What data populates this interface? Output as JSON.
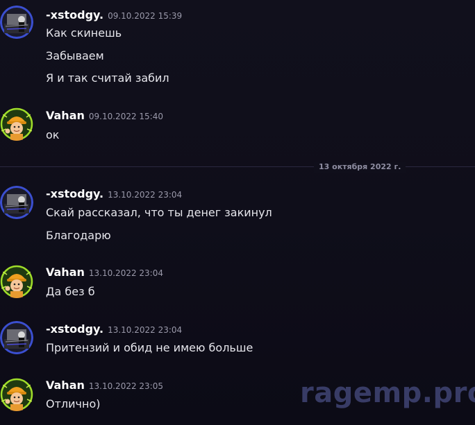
{
  "date_divider": "13 октября 2022 г.",
  "watermark": "ragemp.pro",
  "messages": [
    {
      "username": "-xstodgy.",
      "timestamp": "09.10.2022 15:39",
      "lines": [
        "Как скинешь",
        "Забываем",
        "Я и так считай забил"
      ]
    },
    {
      "username": "Vahan",
      "timestamp": "09.10.2022 15:40",
      "lines": [
        "ок"
      ]
    },
    {
      "username": "-xstodgy.",
      "timestamp": "13.10.2022 23:04",
      "lines": [
        "Скай рассказал, что ты денег закинул",
        "Благодарю"
      ]
    },
    {
      "username": "Vahan",
      "timestamp": "13.10.2022 23:04",
      "lines": [
        "Да без б"
      ]
    },
    {
      "username": "-xstodgy.",
      "timestamp": "13.10.2022 23:04",
      "lines": [
        "Притензий и обид не имею больше"
      ]
    },
    {
      "username": "Vahan",
      "timestamp": "13.10.2022 23:05",
      "lines": [
        "Отлично)"
      ]
    }
  ]
}
